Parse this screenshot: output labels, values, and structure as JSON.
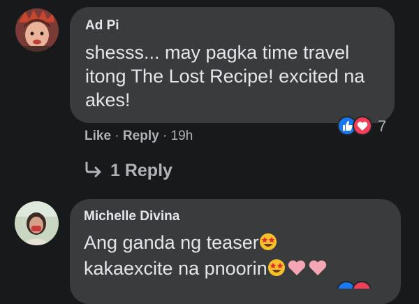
{
  "comments": [
    {
      "author": "Ad Pi",
      "text": "shesss... may pagka time travel itong The Lost Recipe! excited na akes!",
      "actions": {
        "like": "Like",
        "sep1": " · ",
        "reply": "Reply",
        "sep2": " · ",
        "time": "19h"
      },
      "reactions": {
        "icons": [
          "like-icon",
          "love-icon"
        ],
        "count": "7"
      },
      "replies": {
        "label": "1 Reply",
        "icon": "reply-arrow-icon"
      }
    },
    {
      "author": "Michelle Divina",
      "line1": "Ang ganda ng teaser",
      "line2": "kakaexcite na pnoorin"
    }
  ],
  "colors": {
    "background": "#18191a",
    "bubble": "#3a3b3c",
    "text": "#e4e6eb",
    "secondary": "#b0b3b8",
    "like_blue": "#1877f2",
    "love_red": "#f33e58"
  }
}
